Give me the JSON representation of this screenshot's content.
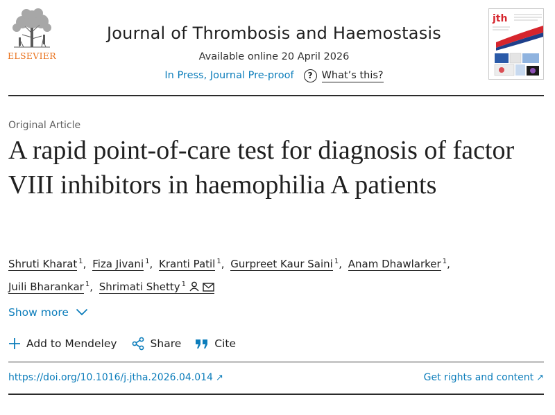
{
  "header": {
    "publisher": "ELSEVIER",
    "journal_title": "Journal of Thrombosis and Haemostasis",
    "available_online": "Available online 20 April 2026",
    "in_press": "In Press, Journal Pre-proof",
    "whats_this": "What’s this?",
    "whats_this_icon": "question-circle-icon",
    "cover_abbrev": "jth"
  },
  "article": {
    "type": "Original Article",
    "title": "A rapid point-of-care test for diagnosis of factor VIII inhibitors in haemophilia A patients",
    "authors": [
      {
        "name": "Shruti Kharat",
        "affil": "1"
      },
      {
        "name": "Fiza Jivani",
        "affil": "1"
      },
      {
        "name": "Kranti Patil",
        "affil": "1"
      },
      {
        "name": "Gurpreet Kaur Saini",
        "affil": "1"
      },
      {
        "name": "Anam Dhawlarker",
        "affil": "1"
      },
      {
        "name": "Juili Bharankar",
        "affil": "1"
      },
      {
        "name": "Shrimati Shetty",
        "affil": "1",
        "icons": [
          "person-icon",
          "mail-icon"
        ]
      }
    ],
    "show_more": "Show more"
  },
  "actions": {
    "add_mendeley": "Add to Mendeley",
    "share": "Share",
    "cite": "Cite"
  },
  "links": {
    "doi": "https://doi.org/10.1016/j.jtha.2026.04.014",
    "rights": "Get rights and content"
  },
  "colors": {
    "accent_link": "#0c7dbb",
    "elsevier_orange": "#e9711c",
    "text": "#1f1f1f"
  }
}
